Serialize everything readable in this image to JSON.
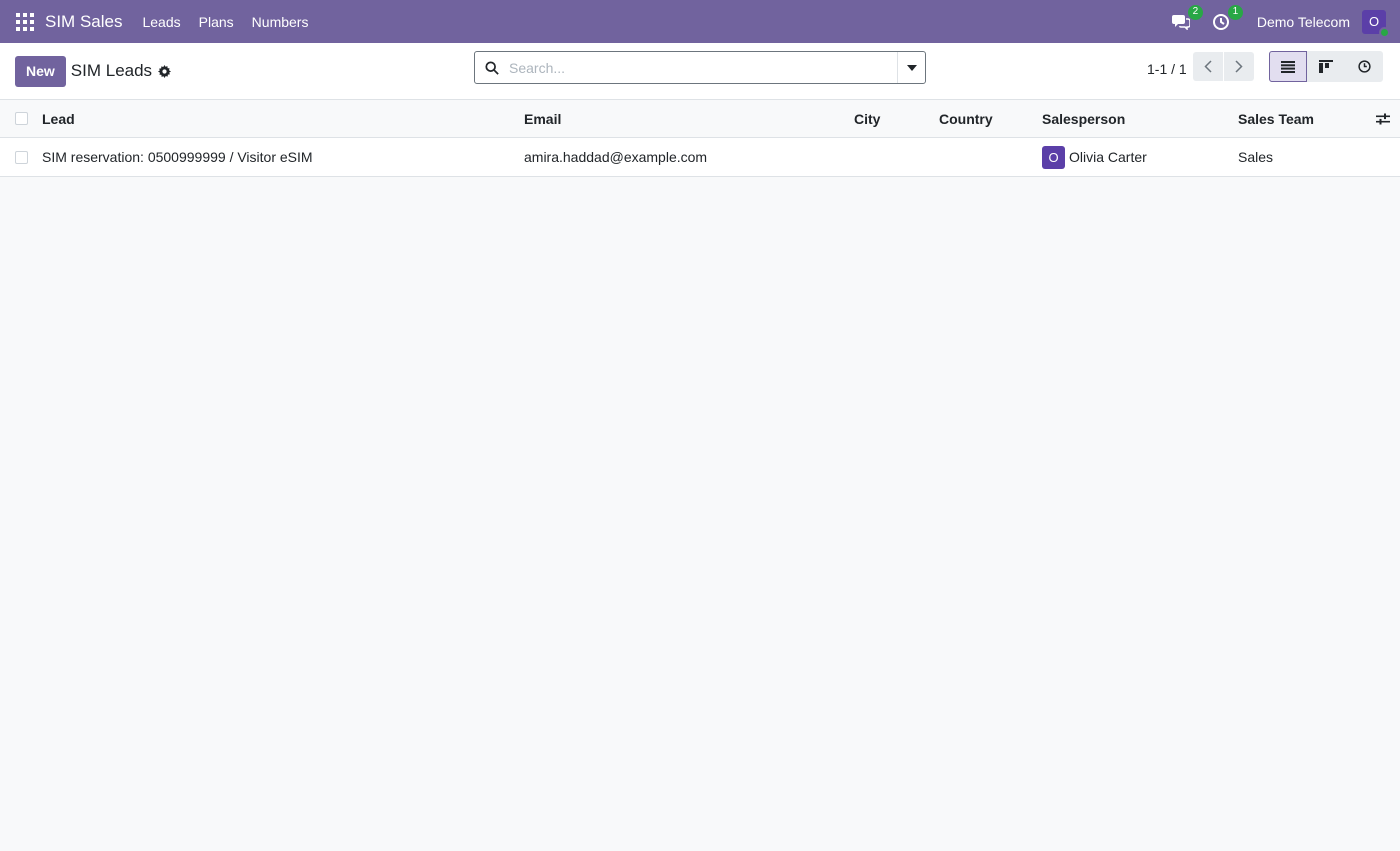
{
  "navbar": {
    "brand": "SIM Sales",
    "menu": [
      "Leads",
      "Plans",
      "Numbers"
    ],
    "messages_count": "2",
    "activities_count": "1",
    "company": "Demo Telecom",
    "user_initial": "O",
    "icons": [
      "apps-grid-icon",
      "chat-icon",
      "clock-icon"
    ],
    "accent_color": "#71639e"
  },
  "control": {
    "new_label": "New",
    "title": "SIM Leads",
    "search_placeholder": "Search...",
    "pager": "1-1 / 1"
  },
  "table": {
    "columns": [
      "Lead",
      "Email",
      "City",
      "Country",
      "Salesperson",
      "Sales Team"
    ],
    "rows": [
      {
        "lead": "SIM reservation: 0500999999 / Visitor eSIM",
        "email": "amira.haddad@example.com",
        "city": "",
        "country": "",
        "salesperson_initial": "O",
        "salesperson": "Olivia Carter",
        "sales_team": "Sales"
      }
    ]
  }
}
